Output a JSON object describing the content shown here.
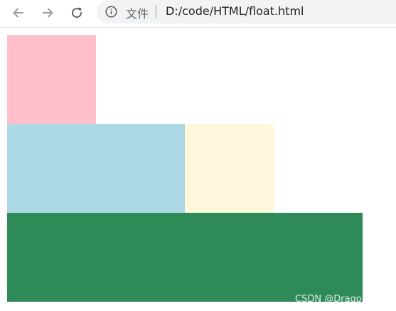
{
  "browser": {
    "back_icon": "arrow-left-icon",
    "forward_icon": "arrow-right-icon",
    "reload_icon": "reload-icon",
    "info_icon": "info-circle-icon",
    "scheme_label": "文件",
    "url": "D:/code/HTML/float.html"
  },
  "page": {
    "boxes": [
      {
        "name": "pink-box",
        "color": "#ffc0cb"
      },
      {
        "name": "lightblue-box",
        "color": "#add8e6"
      },
      {
        "name": "cornsilk-box",
        "color": "#fff8dc"
      },
      {
        "name": "seagreen-box",
        "color": "#2e8b57"
      }
    ]
  },
  "watermark": "CSDN @Dragon水魅"
}
